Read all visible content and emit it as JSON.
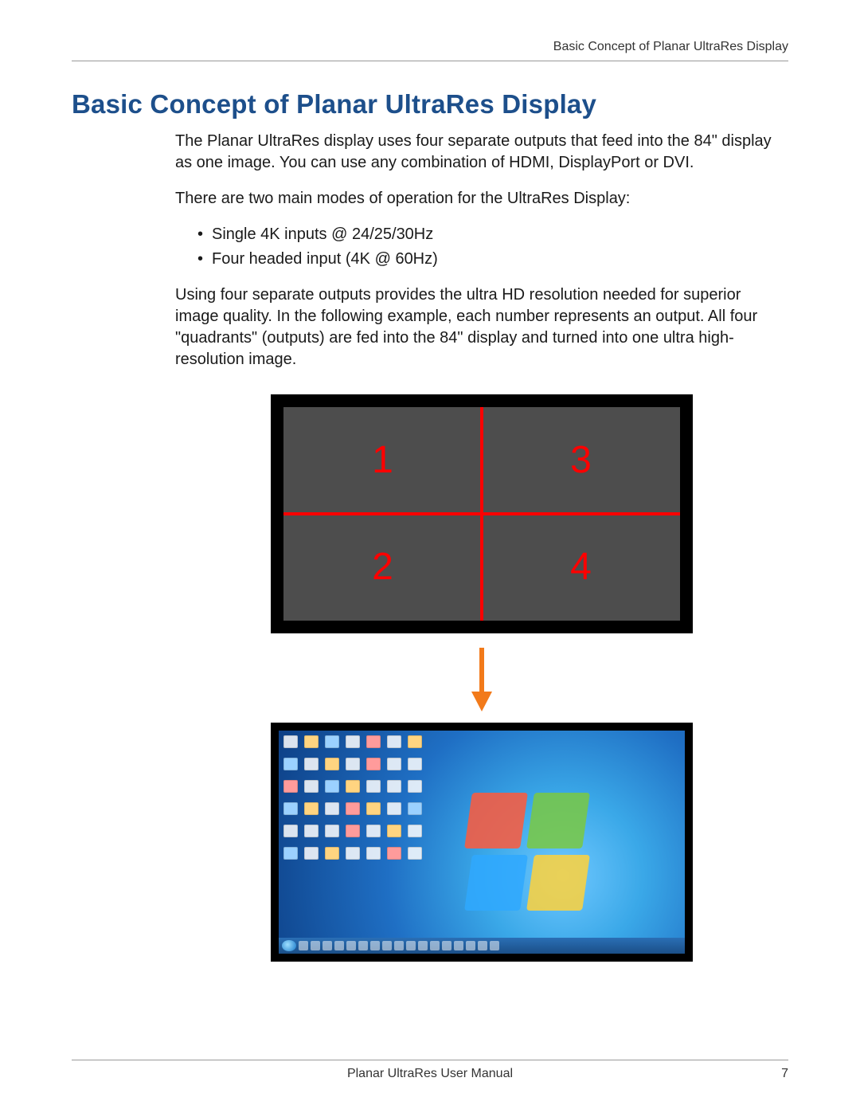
{
  "header": {
    "running_title": "Basic Concept of Planar UltraRes Display"
  },
  "title": "Basic Concept of Planar UltraRes Display",
  "paragraphs": {
    "p1": "The Planar UltraRes display uses four separate outputs that feed into the 84\" display as one image. You can use any combination of HDMI, DisplayPort or DVI.",
    "p2": "There are two main modes of operation for the UltraRes Display:",
    "p3": "Using four separate outputs provides the ultra HD resolution needed for superior image quality. In the following example, each number represents an output. All four \"quadrants\" (outputs) are fed into the 84\" display and turned into one ultra high-resolution image."
  },
  "modes": [
    "Single 4K inputs @ 24/25/30Hz",
    "Four headed input (4K @ 60Hz)"
  ],
  "quadrants": {
    "tl": "1",
    "tr": "3",
    "bl": "2",
    "br": "4"
  },
  "footer": {
    "center": "Planar UltraRes User Manual",
    "page": "7"
  },
  "colors": {
    "heading": "#1d4f8b",
    "quad_line": "#ff0000",
    "arrow": "#f27a1a"
  }
}
